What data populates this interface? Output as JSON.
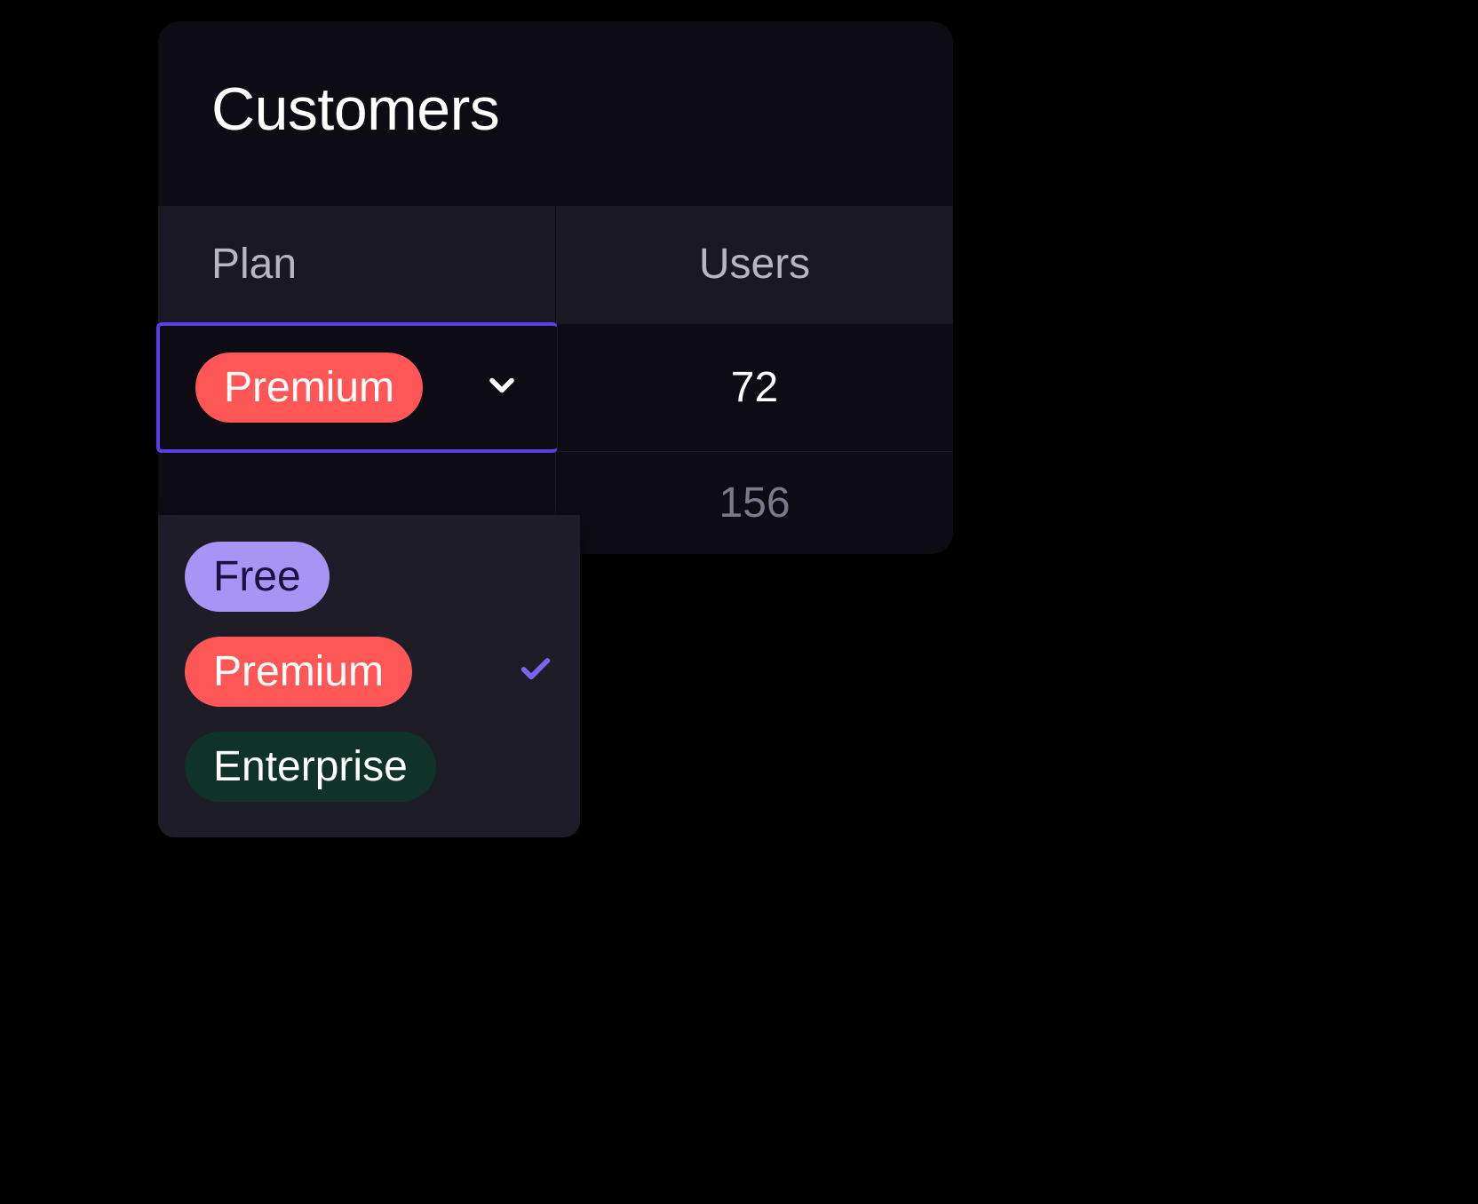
{
  "title": "Customers",
  "columns": {
    "plan": "Plan",
    "users": "Users"
  },
  "rows": [
    {
      "plan_label": "Premium",
      "users": "72",
      "selected": true
    },
    {
      "plan_label": "",
      "users": "156",
      "selected": false
    }
  ],
  "dropdown": {
    "options": [
      {
        "label": "Free",
        "variant": "free",
        "selected": false
      },
      {
        "label": "Premium",
        "variant": "premium",
        "selected": true
      },
      {
        "label": "Enterprise",
        "variant": "enterprise",
        "selected": false
      }
    ]
  },
  "colors": {
    "highlight": "#5B3EE8",
    "premium": "#FF5757",
    "free": "#A794F5",
    "enterprise": "#103329"
  }
}
